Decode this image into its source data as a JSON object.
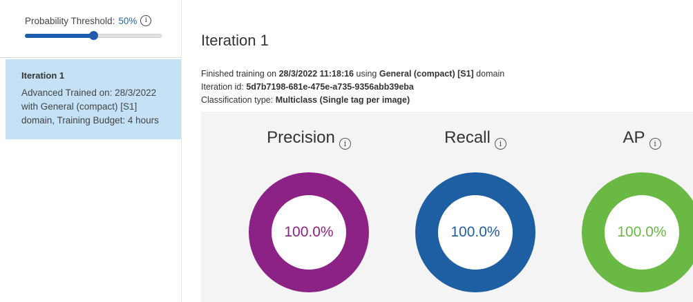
{
  "sidebar": {
    "threshold": {
      "label": "Probability Threshold:",
      "value_text": "50%",
      "value": 0.5
    },
    "iteration_card": {
      "title": "Iteration 1",
      "description": "Advanced Trained on: 28/3/2022 with General (compact) [S1] domain, Training Budget: 4 hours"
    }
  },
  "main": {
    "title": "Iteration 1",
    "line1": {
      "prefix": "Finished training on ",
      "datetime": "28/3/2022 11:18:16",
      "middle": " using ",
      "domain_name": "General (compact) [S1]",
      "suffix": " domain"
    },
    "line2": {
      "prefix": "Iteration id: ",
      "iteration_id": "5d7b7198-681e-475e-a735-9356abb39eba"
    },
    "line3": {
      "prefix": "Classification type: ",
      "type": "Multiclass (Single tag per image)"
    },
    "metrics": [
      {
        "name": "Precision",
        "value_text": "100.0%",
        "value": 100.0,
        "color": "#8d2286"
      },
      {
        "name": "Recall",
        "value_text": "100.0%",
        "value": 100.0,
        "color": "#1e5fa3"
      },
      {
        "name": "AP",
        "value_text": "100.0%",
        "value": 100.0,
        "color": "#6ab944"
      }
    ]
  }
}
